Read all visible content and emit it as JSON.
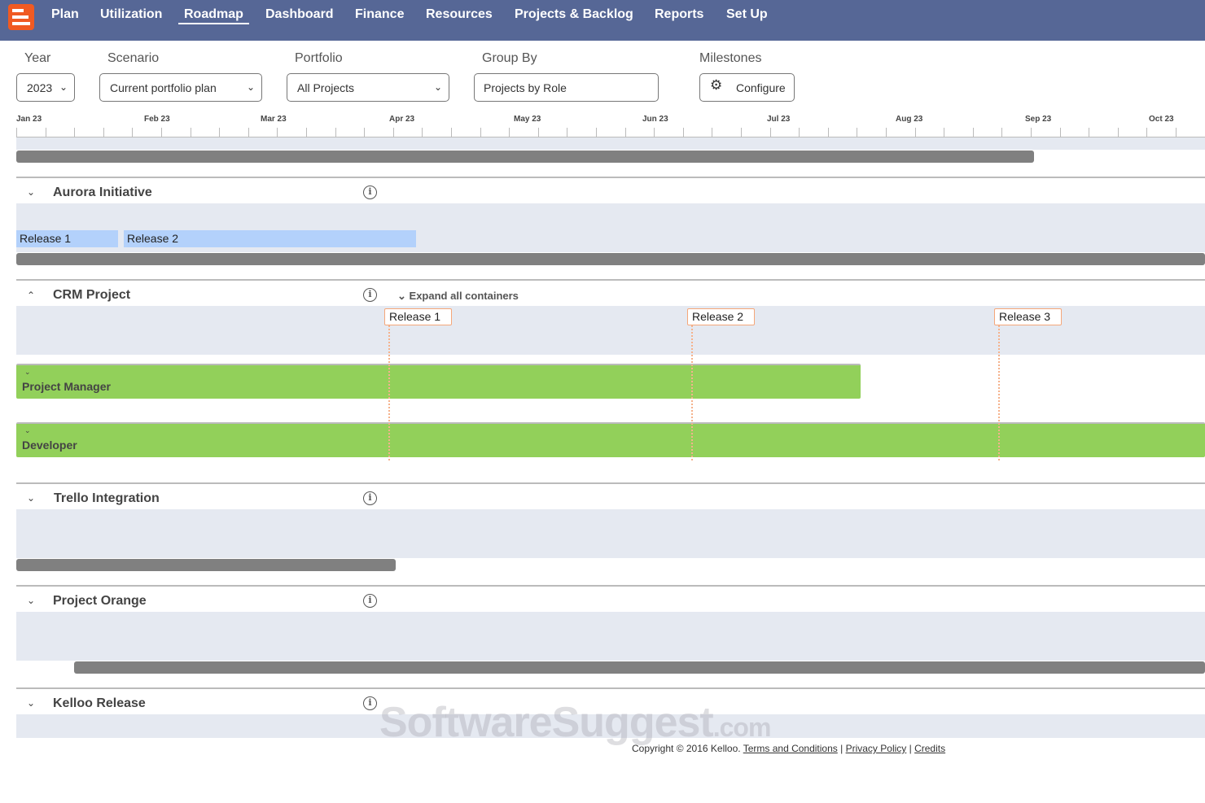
{
  "nav": {
    "items": [
      "Plan",
      "Utilization",
      "Roadmap",
      "Dashboard",
      "Finance",
      "Resources",
      "Projects & Backlog",
      "Reports",
      "Set Up"
    ],
    "active": "Roadmap"
  },
  "filters": {
    "year_label": "Year",
    "year": "2023",
    "scenario_label": "Scenario",
    "scenario": "Current portfolio plan",
    "portfolio_label": "Portfolio",
    "portfolio": "All Projects",
    "groupby_label": "Group By",
    "groupby": "Projects by Role",
    "milestones_label": "Milestones",
    "configure": "Configure"
  },
  "timeline": {
    "months": [
      "Jan 23",
      "Feb 23",
      "Mar 23",
      "Apr 23",
      "May 23",
      "Jun 23",
      "Jul 23",
      "Aug 23",
      "Sep 23",
      "Oct 23"
    ]
  },
  "sections": {
    "aurora": {
      "title": "Aurora Initiative",
      "releases": [
        "Release 1",
        "Release 2"
      ]
    },
    "crm": {
      "title": "CRM Project",
      "expand": "Expand all containers",
      "milestones": [
        "Release 1",
        "Release 2",
        "Release 3"
      ],
      "roles": [
        "Project Manager",
        "Developer"
      ]
    },
    "trello": {
      "title": "Trello Integration"
    },
    "orange": {
      "title": "Project Orange"
    },
    "kelloo": {
      "title": "Kelloo Release"
    }
  },
  "footer": {
    "copyright": "Copyright © 2016 Kelloo.",
    "terms": "Terms and Conditions",
    "privacy": "Privacy Policy",
    "credits": "Credits",
    "sep": "|"
  },
  "watermark": "SoftwareSuggest.com",
  "colors": {
    "nav": "#566796",
    "brand": "#f05a22",
    "role_bar": "#92d05a",
    "release": "#b3d1fb",
    "milestone": "#f5a77a"
  }
}
